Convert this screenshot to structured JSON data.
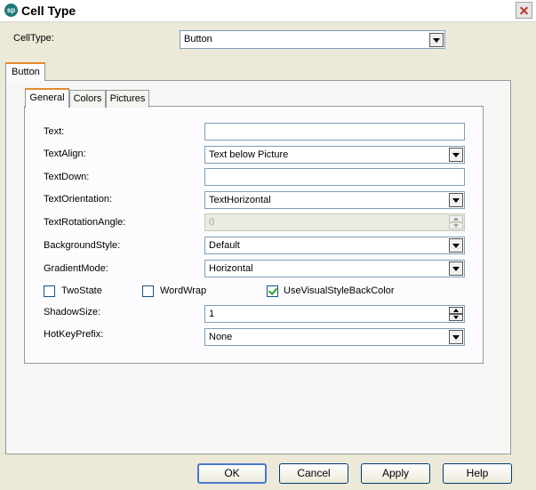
{
  "window": {
    "title": "Cell Type",
    "app_icon_text": "sp",
    "close_icon": "close-icon"
  },
  "celltype": {
    "label": "CellType:",
    "value": "Button"
  },
  "outer_tabs": [
    {
      "label": "Button",
      "active": true
    }
  ],
  "inner_tabs": [
    {
      "label": "General",
      "active": true
    },
    {
      "label": "Colors",
      "active": false
    },
    {
      "label": "Pictures",
      "active": false
    }
  ],
  "general": {
    "text": {
      "label": "Text:",
      "value": ""
    },
    "textalign": {
      "label": "TextAlign:",
      "value": "Text below Picture"
    },
    "textdown": {
      "label": "TextDown:",
      "value": ""
    },
    "textorientation": {
      "label": "TextOrientation:",
      "value": "TextHorizontal"
    },
    "textrotationangle": {
      "label": "TextRotationAngle:",
      "value": "0",
      "enabled": false
    },
    "backgroundstyle": {
      "label": "BackgroundStyle:",
      "value": "Default"
    },
    "gradientmode": {
      "label": "GradientMode:",
      "value": "Horizontal"
    },
    "checkboxes": [
      {
        "label": "TwoState",
        "checked": false
      },
      {
        "label": "WordWrap",
        "checked": false
      },
      {
        "label": "UseVisualStyleBackColor",
        "checked": true
      }
    ],
    "shadowsize": {
      "label": "ShadowSize:",
      "value": "1"
    },
    "hotkeyprefix": {
      "label": "HotKeyPrefix:",
      "value": "None"
    }
  },
  "buttons": {
    "ok": "OK",
    "cancel": "Cancel",
    "apply": "Apply",
    "help": "Help"
  }
}
